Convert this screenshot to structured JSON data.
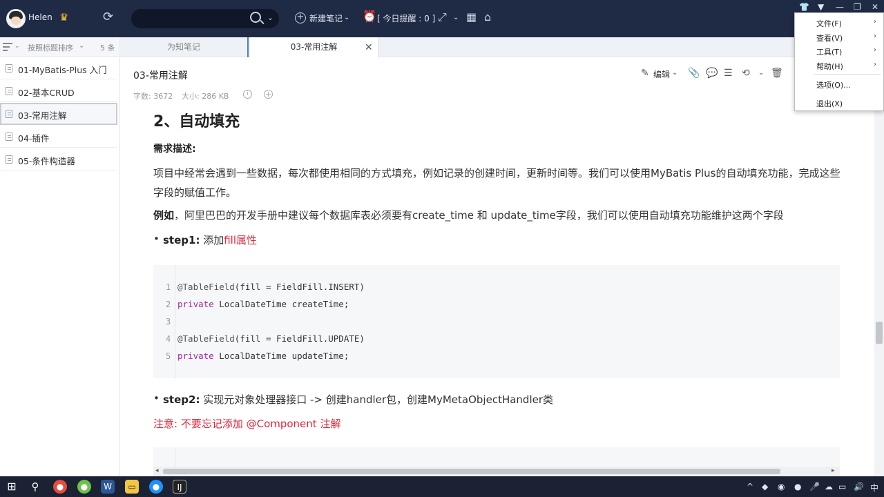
{
  "topbar": {
    "username": "Helen",
    "new_note": "新建笔记",
    "reminder": "[ 今日提醒 : 0 ]"
  },
  "menu": {
    "items": [
      {
        "label": "文件(F)",
        "has_submenu": true
      },
      {
        "label": "查看(V)",
        "has_submenu": true
      },
      {
        "label": "工具(T)",
        "has_submenu": true
      },
      {
        "label": "帮助(H)",
        "has_submenu": true
      },
      {
        "label": "选项(O)...",
        "has_submenu": false
      },
      {
        "label": "退出(X)",
        "has_submenu": false
      }
    ]
  },
  "sidebar": {
    "sort_label": "按照标题排序",
    "count": "5 条",
    "notes": [
      "01-MyBatis-Plus 入门",
      "02-基本CRUD",
      "03-常用注解",
      "04-插件",
      "05-条件构造器"
    ],
    "active_index": 2
  },
  "tabs": [
    "为知笔记",
    "03-常用注解"
  ],
  "note": {
    "title": "03-常用注解",
    "word_count": "字数: 3672",
    "size": "大小: 286 KB",
    "edit_label": "编辑"
  },
  "content": {
    "heading": "2、自动填充",
    "req_title": "需求描述:",
    "paragraph": "项目中经常会遇到一些数据，每次都使用相同的方式填充，例如记录的创建时间，更新时间等。我们可以使用MyBatis Plus的自动填充功能，完成这些字段的赋值工作。",
    "example_bold": "例如",
    "example_text": "，阿里巴巴的开发手册中建议每个数据库表必须要有create_time 和 update_time字段，我们可以使用自动填充功能维护这两个字段",
    "step1_bold": "step1:",
    "step1_text": " 添加",
    "step1_red": "fill属性",
    "code_lines": [
      {
        "n": "1",
        "anno": "@TableField",
        "rest": "(fill = FieldFill.INSERT)",
        "kw": ""
      },
      {
        "n": "2",
        "anno": "",
        "rest": " LocalDateTime createTime;",
        "kw": "private"
      },
      {
        "n": "3",
        "anno": "",
        "rest": "",
        "kw": ""
      },
      {
        "n": "4",
        "anno": "@TableField",
        "rest": "(fill = FieldFill.UPDATE)",
        "kw": ""
      },
      {
        "n": "5",
        "anno": "",
        "rest": " LocalDateTime updateTime;",
        "kw": "private"
      }
    ],
    "step2_bold": "step2:",
    "step2_text": " 实现元对象处理器接口 -> 创建handler包，创建MyMetaObjectHandler类",
    "note_red": "注意: 不要忘记添加 @Component 注解"
  },
  "taskbar": {
    "ime": "中"
  },
  "colors": {
    "topbar": "#1f2a44",
    "accent": "#4c7fc6",
    "red_text": "#e0263a"
  }
}
